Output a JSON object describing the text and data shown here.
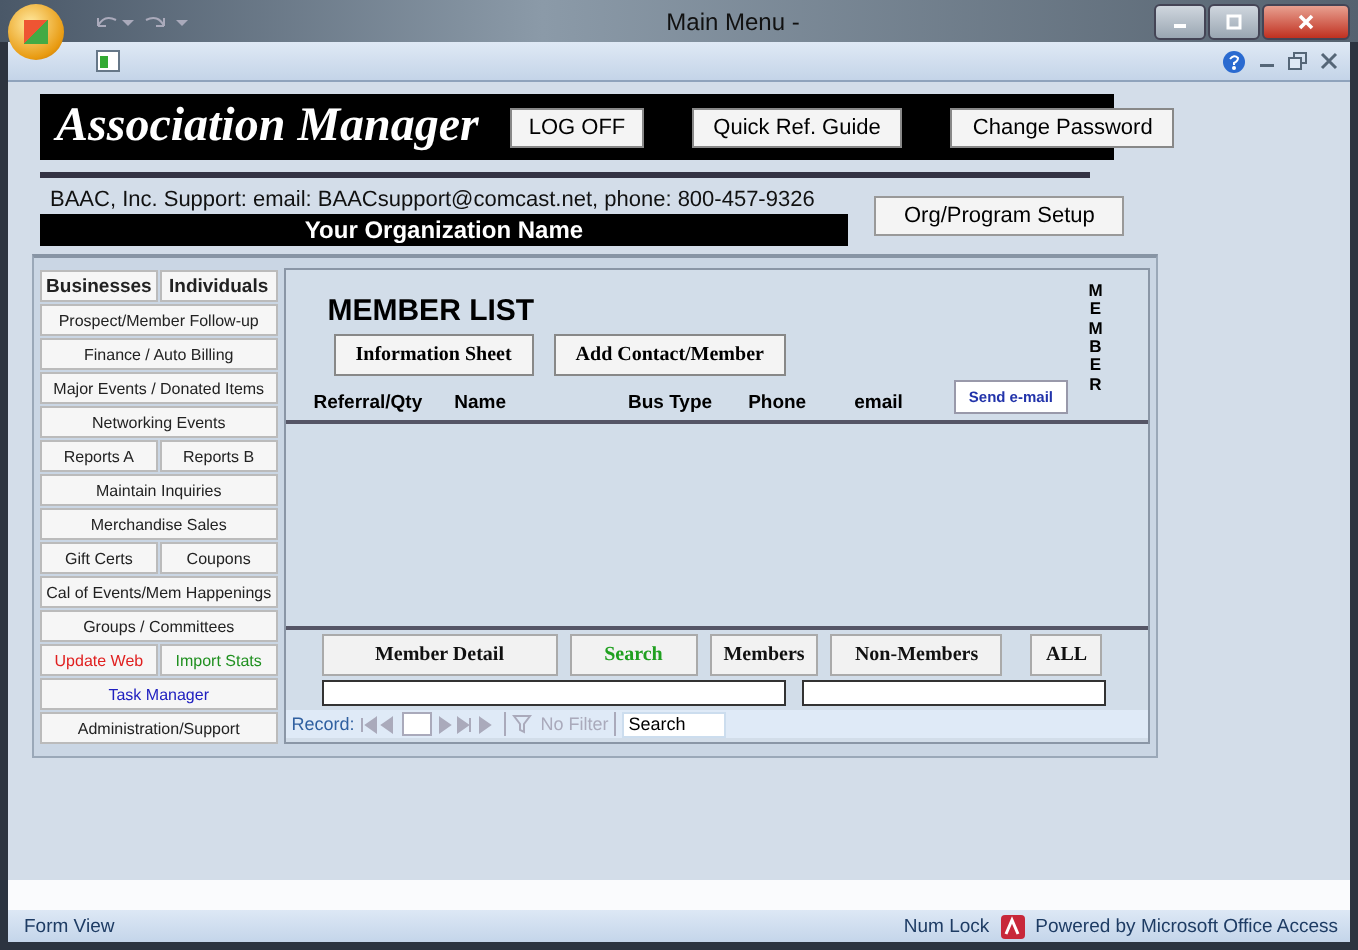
{
  "window": {
    "title": "Main Menu -"
  },
  "header": {
    "app_title": "Association Manager",
    "buttons": [
      "LOG OFF",
      "Quick Ref. Guide",
      "Change Password"
    ]
  },
  "support_text": "BAAC, Inc. Support:  email: BAACsupport@comcast.net, phone: 800-457-9326",
  "organization_name": "Your Organization Name",
  "setup_button": "Org/Program Setup",
  "sidebar": {
    "rows": [
      [
        {
          "label": "Businesses",
          "bold": true
        },
        {
          "label": "Individuals",
          "bold": true
        }
      ],
      [
        {
          "label": "Prospect/Member Follow-up"
        }
      ],
      [
        {
          "label": "Finance / Auto Billing"
        }
      ],
      [
        {
          "label": "Major Events / Donated Items"
        }
      ],
      [
        {
          "label": "Networking Events"
        }
      ],
      [
        {
          "label": "Reports A"
        },
        {
          "label": "Reports B"
        }
      ],
      [
        {
          "label": "Maintain Inquiries"
        }
      ],
      [
        {
          "label": "Merchandise Sales"
        }
      ],
      [
        {
          "label": "Gift Certs"
        },
        {
          "label": "Coupons"
        }
      ],
      [
        {
          "label": "Cal of Events/Mem Happenings"
        }
      ],
      [
        {
          "label": "Groups / Committees"
        }
      ],
      [
        {
          "label": "Update Web",
          "color": "#e02020"
        },
        {
          "label": "Import Stats",
          "color": "#209020"
        }
      ],
      [
        {
          "label": "Task Manager",
          "color": "#2020c0"
        }
      ],
      [
        {
          "label": "Administration/Support"
        }
      ]
    ]
  },
  "member_list": {
    "title": "MEMBER LIST",
    "buttons": [
      "Information Sheet",
      "Add Contact/Member"
    ],
    "columns": [
      "Referral/Qty",
      "Name",
      "Bus Type",
      "Phone",
      "email"
    ],
    "send_button": "Send e-mail",
    "vertical_label": "MEMBER",
    "bottom_buttons": [
      {
        "label": "Member Detail"
      },
      {
        "label": "Search",
        "color": "#20a020"
      },
      {
        "label": "Members"
      },
      {
        "label": "Non-Members"
      },
      {
        "label": "ALL"
      }
    ],
    "navigator": {
      "record_label": "Record:",
      "filter": "No Filter",
      "search": "Search"
    }
  },
  "status_bar": {
    "left": "Form View",
    "num_lock": "Num Lock",
    "powered_by": "Powered by Microsoft Office Access"
  }
}
